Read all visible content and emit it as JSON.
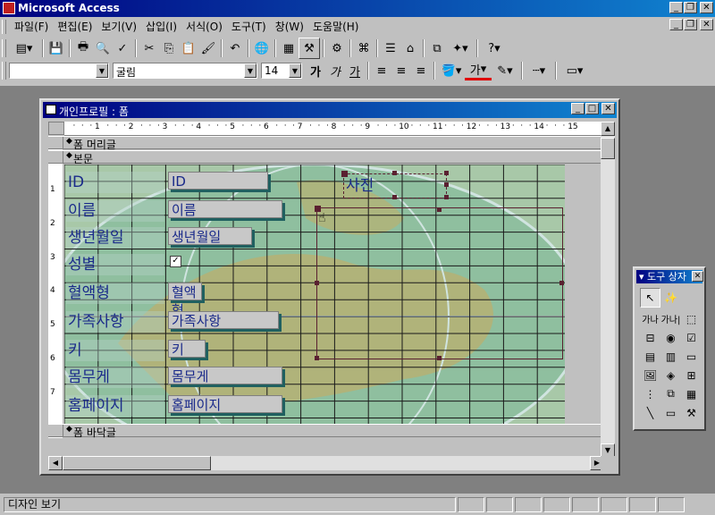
{
  "app": {
    "title": "Microsoft Access"
  },
  "menu": [
    "파일(F)",
    "편집(E)",
    "보기(V)",
    "삽입(I)",
    "서식(O)",
    "도구(T)",
    "창(W)",
    "도움말(H)"
  ],
  "format_toolbar": {
    "object_value": "",
    "font_value": "굴림",
    "size_value": "14",
    "bold": "가",
    "italic": "가",
    "underline": "가",
    "fill_color_icon": "가"
  },
  "form_window": {
    "title": "개인프로필 : 폼",
    "sections": {
      "header": "폼 머리글",
      "detail": "본문",
      "footer": "폼 바닥글"
    },
    "ruler_numbers": [
      "1",
      "2",
      "3",
      "4",
      "5",
      "6",
      "7",
      "8",
      "9",
      "10",
      "11",
      "12",
      "13",
      "14",
      "15"
    ],
    "left_ruler_numbers": [
      "1",
      "2",
      "3",
      "4",
      "5",
      "6",
      "7"
    ],
    "labels": [
      "ID",
      "이름",
      "생년월일",
      "성별",
      "혈액형",
      "가족사항",
      "키",
      "몸무게",
      "홈페이지"
    ],
    "textboxes": [
      "ID",
      "이름",
      "생년월일",
      "혈액형",
      "가족사항",
      "키",
      "몸무게",
      "홈페이지"
    ],
    "photo_label": "사진"
  },
  "toolbox": {
    "title": "도구 상자",
    "label_tool": "가나",
    "textbox_tool": "가나|"
  },
  "status": {
    "mode": "디자인 보기"
  }
}
